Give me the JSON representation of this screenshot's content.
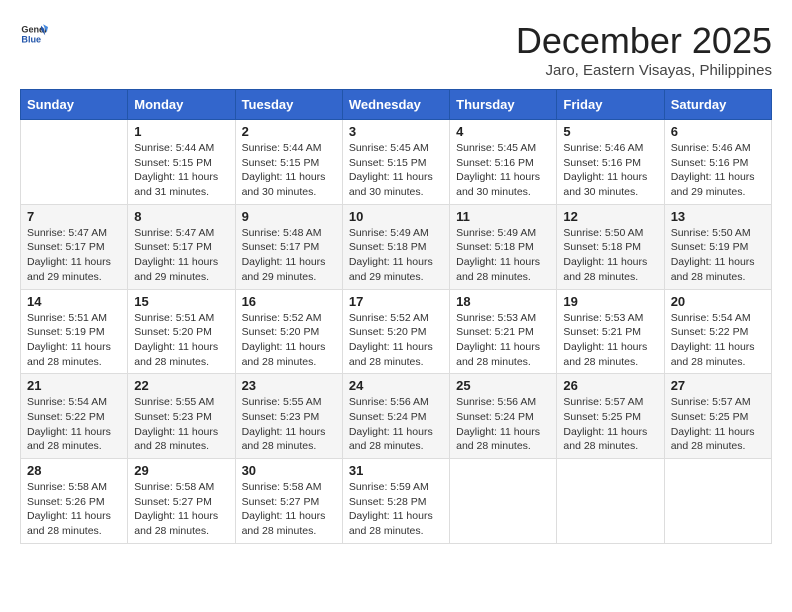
{
  "logo": {
    "text_general": "General",
    "text_blue": "Blue"
  },
  "header": {
    "month_year": "December 2025",
    "location": "Jaro, Eastern Visayas, Philippines"
  },
  "weekdays": [
    "Sunday",
    "Monday",
    "Tuesday",
    "Wednesday",
    "Thursday",
    "Friday",
    "Saturday"
  ],
  "weeks": [
    [
      {
        "day": "",
        "sunrise": "",
        "sunset": "",
        "daylight": ""
      },
      {
        "day": "1",
        "sunrise": "Sunrise: 5:44 AM",
        "sunset": "Sunset: 5:15 PM",
        "daylight": "Daylight: 11 hours and 31 minutes."
      },
      {
        "day": "2",
        "sunrise": "Sunrise: 5:44 AM",
        "sunset": "Sunset: 5:15 PM",
        "daylight": "Daylight: 11 hours and 30 minutes."
      },
      {
        "day": "3",
        "sunrise": "Sunrise: 5:45 AM",
        "sunset": "Sunset: 5:15 PM",
        "daylight": "Daylight: 11 hours and 30 minutes."
      },
      {
        "day": "4",
        "sunrise": "Sunrise: 5:45 AM",
        "sunset": "Sunset: 5:16 PM",
        "daylight": "Daylight: 11 hours and 30 minutes."
      },
      {
        "day": "5",
        "sunrise": "Sunrise: 5:46 AM",
        "sunset": "Sunset: 5:16 PM",
        "daylight": "Daylight: 11 hours and 30 minutes."
      },
      {
        "day": "6",
        "sunrise": "Sunrise: 5:46 AM",
        "sunset": "Sunset: 5:16 PM",
        "daylight": "Daylight: 11 hours and 29 minutes."
      }
    ],
    [
      {
        "day": "7",
        "sunrise": "Sunrise: 5:47 AM",
        "sunset": "Sunset: 5:17 PM",
        "daylight": "Daylight: 11 hours and 29 minutes."
      },
      {
        "day": "8",
        "sunrise": "Sunrise: 5:47 AM",
        "sunset": "Sunset: 5:17 PM",
        "daylight": "Daylight: 11 hours and 29 minutes."
      },
      {
        "day": "9",
        "sunrise": "Sunrise: 5:48 AM",
        "sunset": "Sunset: 5:17 PM",
        "daylight": "Daylight: 11 hours and 29 minutes."
      },
      {
        "day": "10",
        "sunrise": "Sunrise: 5:49 AM",
        "sunset": "Sunset: 5:18 PM",
        "daylight": "Daylight: 11 hours and 29 minutes."
      },
      {
        "day": "11",
        "sunrise": "Sunrise: 5:49 AM",
        "sunset": "Sunset: 5:18 PM",
        "daylight": "Daylight: 11 hours and 28 minutes."
      },
      {
        "day": "12",
        "sunrise": "Sunrise: 5:50 AM",
        "sunset": "Sunset: 5:18 PM",
        "daylight": "Daylight: 11 hours and 28 minutes."
      },
      {
        "day": "13",
        "sunrise": "Sunrise: 5:50 AM",
        "sunset": "Sunset: 5:19 PM",
        "daylight": "Daylight: 11 hours and 28 minutes."
      }
    ],
    [
      {
        "day": "14",
        "sunrise": "Sunrise: 5:51 AM",
        "sunset": "Sunset: 5:19 PM",
        "daylight": "Daylight: 11 hours and 28 minutes."
      },
      {
        "day": "15",
        "sunrise": "Sunrise: 5:51 AM",
        "sunset": "Sunset: 5:20 PM",
        "daylight": "Daylight: 11 hours and 28 minutes."
      },
      {
        "day": "16",
        "sunrise": "Sunrise: 5:52 AM",
        "sunset": "Sunset: 5:20 PM",
        "daylight": "Daylight: 11 hours and 28 minutes."
      },
      {
        "day": "17",
        "sunrise": "Sunrise: 5:52 AM",
        "sunset": "Sunset: 5:20 PM",
        "daylight": "Daylight: 11 hours and 28 minutes."
      },
      {
        "day": "18",
        "sunrise": "Sunrise: 5:53 AM",
        "sunset": "Sunset: 5:21 PM",
        "daylight": "Daylight: 11 hours and 28 minutes."
      },
      {
        "day": "19",
        "sunrise": "Sunrise: 5:53 AM",
        "sunset": "Sunset: 5:21 PM",
        "daylight": "Daylight: 11 hours and 28 minutes."
      },
      {
        "day": "20",
        "sunrise": "Sunrise: 5:54 AM",
        "sunset": "Sunset: 5:22 PM",
        "daylight": "Daylight: 11 hours and 28 minutes."
      }
    ],
    [
      {
        "day": "21",
        "sunrise": "Sunrise: 5:54 AM",
        "sunset": "Sunset: 5:22 PM",
        "daylight": "Daylight: 11 hours and 28 minutes."
      },
      {
        "day": "22",
        "sunrise": "Sunrise: 5:55 AM",
        "sunset": "Sunset: 5:23 PM",
        "daylight": "Daylight: 11 hours and 28 minutes."
      },
      {
        "day": "23",
        "sunrise": "Sunrise: 5:55 AM",
        "sunset": "Sunset: 5:23 PM",
        "daylight": "Daylight: 11 hours and 28 minutes."
      },
      {
        "day": "24",
        "sunrise": "Sunrise: 5:56 AM",
        "sunset": "Sunset: 5:24 PM",
        "daylight": "Daylight: 11 hours and 28 minutes."
      },
      {
        "day": "25",
        "sunrise": "Sunrise: 5:56 AM",
        "sunset": "Sunset: 5:24 PM",
        "daylight": "Daylight: 11 hours and 28 minutes."
      },
      {
        "day": "26",
        "sunrise": "Sunrise: 5:57 AM",
        "sunset": "Sunset: 5:25 PM",
        "daylight": "Daylight: 11 hours and 28 minutes."
      },
      {
        "day": "27",
        "sunrise": "Sunrise: 5:57 AM",
        "sunset": "Sunset: 5:25 PM",
        "daylight": "Daylight: 11 hours and 28 minutes."
      }
    ],
    [
      {
        "day": "28",
        "sunrise": "Sunrise: 5:58 AM",
        "sunset": "Sunset: 5:26 PM",
        "daylight": "Daylight: 11 hours and 28 minutes."
      },
      {
        "day": "29",
        "sunrise": "Sunrise: 5:58 AM",
        "sunset": "Sunset: 5:27 PM",
        "daylight": "Daylight: 11 hours and 28 minutes."
      },
      {
        "day": "30",
        "sunrise": "Sunrise: 5:58 AM",
        "sunset": "Sunset: 5:27 PM",
        "daylight": "Daylight: 11 hours and 28 minutes."
      },
      {
        "day": "31",
        "sunrise": "Sunrise: 5:59 AM",
        "sunset": "Sunset: 5:28 PM",
        "daylight": "Daylight: 11 hours and 28 minutes."
      },
      {
        "day": "",
        "sunrise": "",
        "sunset": "",
        "daylight": ""
      },
      {
        "day": "",
        "sunrise": "",
        "sunset": "",
        "daylight": ""
      },
      {
        "day": "",
        "sunrise": "",
        "sunset": "",
        "daylight": ""
      }
    ]
  ]
}
